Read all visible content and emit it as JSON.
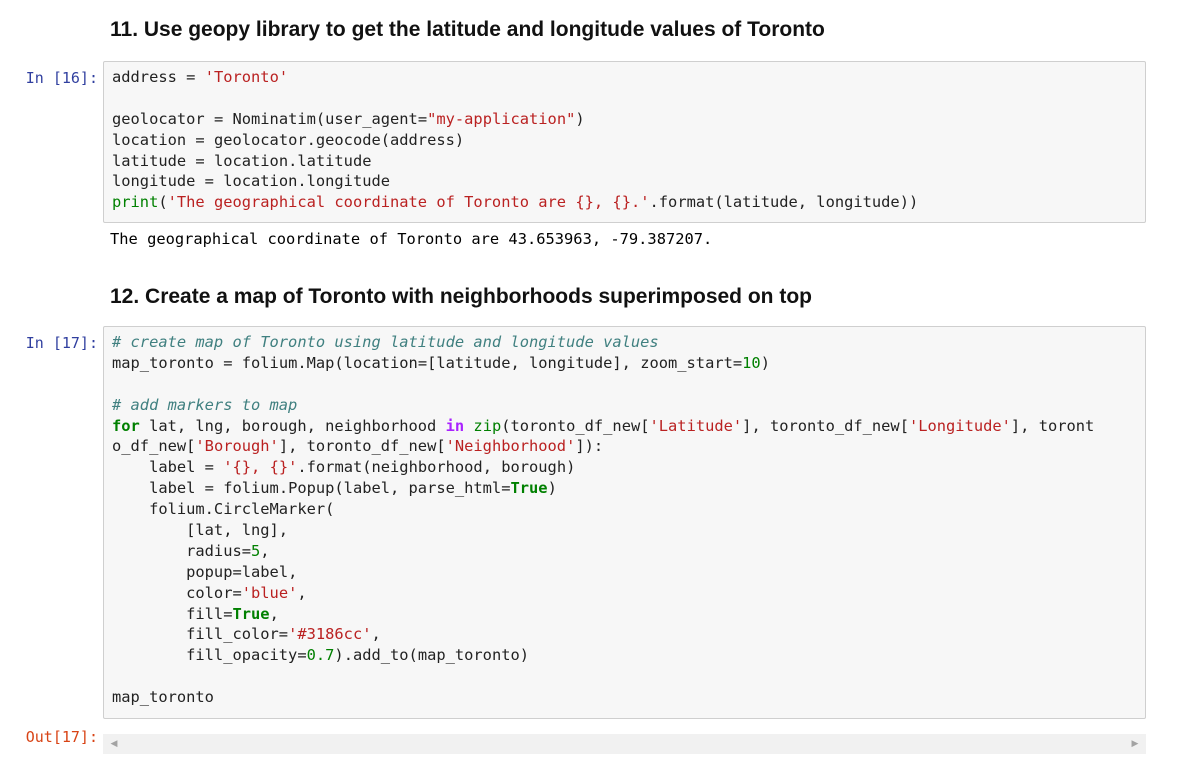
{
  "cells": {
    "heading11": "11. Use geopy library to get the latitude and longitude values of Toronto",
    "prompt16": "In [16]:",
    "output16": "The geographical coordinate of Toronto are 43.653963, -79.387207.",
    "heading12": "12. Create a map of Toronto with neighborhoods superimposed on top",
    "prompt17": "In [17]:",
    "outprompt17": "Out[17]:"
  },
  "code16": [
    [
      [
        "address ",
        ""
      ],
      [
        "=",
        "o"
      ],
      [
        " ",
        ""
      ],
      [
        "'Toronto'",
        "s"
      ]
    ],
    [],
    [
      [
        "geolocator ",
        ""
      ],
      [
        "=",
        "o"
      ],
      [
        " Nominatim(user_agent",
        ""
      ],
      [
        "=",
        "o"
      ],
      [
        "\"my-application\"",
        "s"
      ],
      [
        ")",
        ""
      ]
    ],
    [
      [
        "location ",
        ""
      ],
      [
        "=",
        "o"
      ],
      [
        " geolocator.geocode(address)",
        ""
      ]
    ],
    [
      [
        "latitude ",
        ""
      ],
      [
        "=",
        "o"
      ],
      [
        " location.latitude",
        ""
      ]
    ],
    [
      [
        "longitude ",
        ""
      ],
      [
        "=",
        "o"
      ],
      [
        " location.longitude",
        ""
      ]
    ],
    [
      [
        "print",
        "b"
      ],
      [
        "(",
        ""
      ],
      [
        "'The geographical coordinate of Toronto are ",
        "s"
      ],
      [
        "{}",
        "s"
      ],
      [
        ", ",
        "s"
      ],
      [
        "{}",
        "s"
      ],
      [
        ".'",
        "s"
      ],
      [
        ".format(latitude, longitude))",
        ""
      ]
    ]
  ],
  "code17": [
    [
      [
        "# create map of Toronto using latitude and longitude values",
        "c"
      ]
    ],
    [
      [
        "map_toronto ",
        ""
      ],
      [
        "=",
        "o"
      ],
      [
        " folium.Map(location",
        ""
      ],
      [
        "=",
        "o"
      ],
      [
        "[latitude, longitude], zoom_start",
        ""
      ],
      [
        "=",
        "o"
      ],
      [
        "10",
        "n"
      ],
      [
        ")",
        ""
      ]
    ],
    [],
    [
      [
        "# add markers to map",
        "c"
      ]
    ],
    [
      [
        "for",
        "k"
      ],
      [
        " lat, lng, borough, neighborhood ",
        ""
      ],
      [
        "in",
        "op"
      ],
      [
        " ",
        ""
      ],
      [
        "zip",
        "b"
      ],
      [
        "(toronto_df_new[",
        ""
      ],
      [
        "'Latitude'",
        "s"
      ],
      [
        "], toronto_df_new[",
        ""
      ],
      [
        "'Longitude'",
        "s"
      ],
      [
        "], toront",
        ""
      ]
    ],
    [
      [
        "o_df_new[",
        ""
      ],
      [
        "'Borough'",
        "s"
      ],
      [
        "], toronto_df_new[",
        ""
      ],
      [
        "'Neighborhood'",
        "s"
      ],
      [
        "]):",
        ""
      ]
    ],
    [
      [
        "    label ",
        ""
      ],
      [
        "=",
        "o"
      ],
      [
        " ",
        ""
      ],
      [
        "'{}, {}'",
        "s"
      ],
      [
        ".format(neighborhood, borough)",
        ""
      ]
    ],
    [
      [
        "    label ",
        ""
      ],
      [
        "=",
        "o"
      ],
      [
        " folium.Popup(label, parse_html",
        ""
      ],
      [
        "=",
        "o"
      ],
      [
        "True",
        "k"
      ],
      [
        ")",
        ""
      ]
    ],
    [
      [
        "    folium.CircleMarker(",
        ""
      ]
    ],
    [
      [
        "        [lat, lng],",
        ""
      ]
    ],
    [
      [
        "        radius",
        ""
      ],
      [
        "=",
        "o"
      ],
      [
        "5",
        "n"
      ],
      [
        ",",
        ""
      ]
    ],
    [
      [
        "        popup",
        ""
      ],
      [
        "=",
        "o"
      ],
      [
        "label,",
        ""
      ]
    ],
    [
      [
        "        color",
        ""
      ],
      [
        "=",
        "o"
      ],
      [
        "'blue'",
        "s"
      ],
      [
        ",",
        ""
      ]
    ],
    [
      [
        "        fill",
        ""
      ],
      [
        "=",
        "o"
      ],
      [
        "True",
        "k"
      ],
      [
        ",",
        ""
      ]
    ],
    [
      [
        "        fill_color",
        ""
      ],
      [
        "=",
        "o"
      ],
      [
        "'#3186cc'",
        "s"
      ],
      [
        ",",
        ""
      ]
    ],
    [
      [
        "        fill_opacity",
        ""
      ],
      [
        "=",
        "o"
      ],
      [
        "0.7",
        "n"
      ],
      [
        ").add_to(map_toronto)",
        ""
      ]
    ],
    [],
    [
      [
        "map_toronto",
        ""
      ]
    ]
  ],
  "scroll": {
    "left_arrow": "◀",
    "right_arrow": "▶"
  },
  "colors": {
    "in_prompt": "#303f9f",
    "out_prompt": "#d84315",
    "string": "#ba2121",
    "keyword": "#008000",
    "comment": "#408080",
    "operator_word": "#aa22ff"
  }
}
